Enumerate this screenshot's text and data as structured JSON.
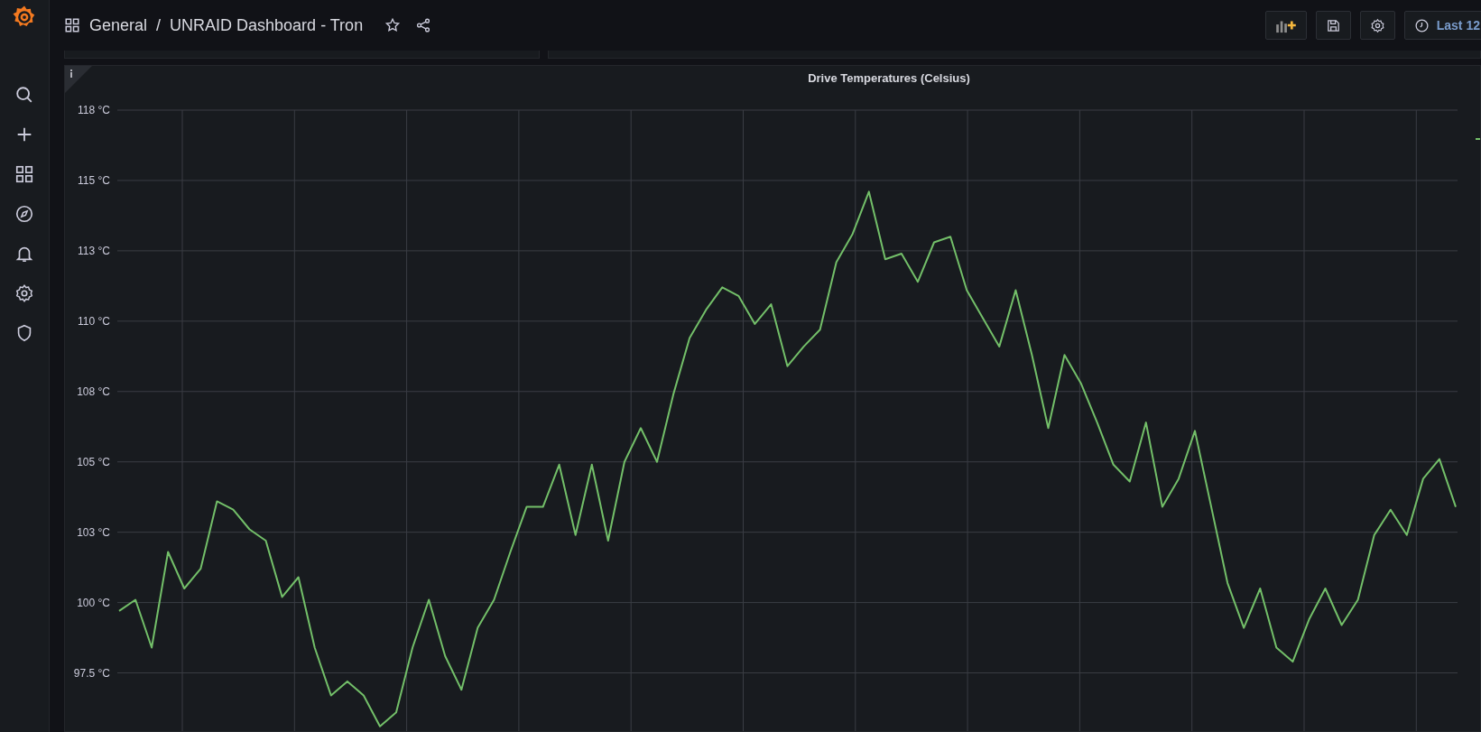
{
  "breadcrumb": {
    "folder": "General",
    "separator": "/",
    "dashboard": "UNRAID Dashboard - Tron"
  },
  "time_picker": {
    "label": "Last 12"
  },
  "panel": {
    "chart_data": {
      "type": "line",
      "title": "Drive Temperatures (Celsius)",
      "grid": true,
      "ylim": [
        95.4,
        117.5
      ],
      "yticks": [
        {
          "value": 117.5,
          "label": "118 °C"
        },
        {
          "value": 115,
          "label": "115 °C"
        },
        {
          "value": 112.5,
          "label": "113 °C"
        },
        {
          "value": 110,
          "label": "110 °C"
        },
        {
          "value": 107.5,
          "label": "108 °C"
        },
        {
          "value": 105,
          "label": "105 °C"
        },
        {
          "value": 102.5,
          "label": "103 °C"
        },
        {
          "value": 100,
          "label": "100 °C"
        },
        {
          "value": 97.5,
          "label": "97.5 °C"
        }
      ],
      "series": [
        {
          "color": "#73bf69",
          "values": [
            99.7,
            100.1,
            98.4,
            101.8,
            100.5,
            101.2,
            103.6,
            103.3,
            102.6,
            102.2,
            100.2,
            100.9,
            98.4,
            96.7,
            97.2,
            96.7,
            95.6,
            96.1,
            98.4,
            100.1,
            98.1,
            96.9,
            99.1,
            100.1,
            101.8,
            103.4,
            103.4,
            104.9,
            102.4,
            104.9,
            102.2,
            105.0,
            106.2,
            105.0,
            107.4,
            109.4,
            110.4,
            111.2,
            110.9,
            109.9,
            110.6,
            108.4,
            109.1,
            109.7,
            112.1,
            113.1,
            114.6,
            112.2,
            112.4,
            111.4,
            112.8,
            113.0,
            111.1,
            110.1,
            109.1,
            111.1,
            108.8,
            106.2,
            108.8,
            107.8,
            106.4,
            104.9,
            104.3,
            106.4,
            103.4,
            104.4,
            106.1,
            103.4,
            100.7,
            99.1,
            100.5,
            98.4,
            97.9,
            99.4,
            100.5,
            99.2,
            100.1,
            102.4,
            103.3,
            102.4,
            104.4,
            105.1,
            103.4
          ]
        }
      ]
    }
  }
}
